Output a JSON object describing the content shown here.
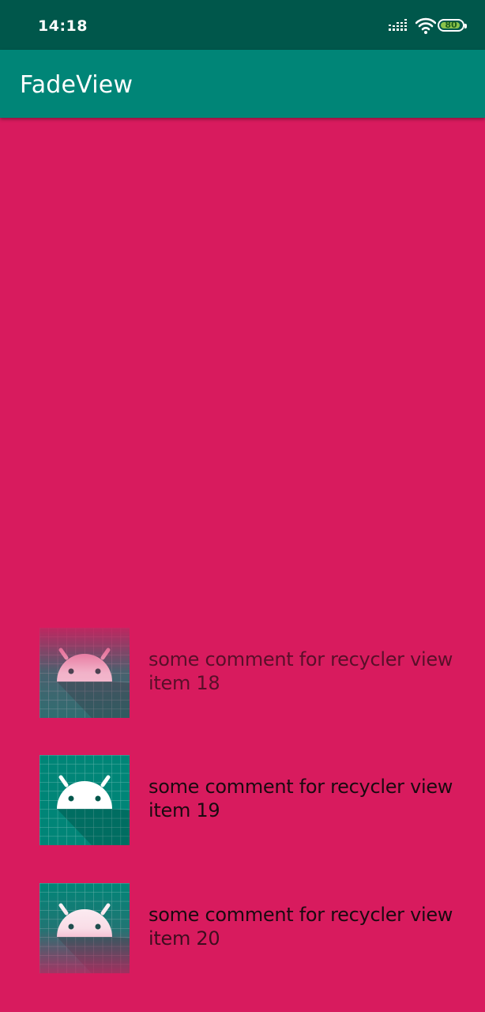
{
  "status_bar": {
    "time": "14:18",
    "battery": "80"
  },
  "app_bar": {
    "title": "FadeView"
  },
  "list": {
    "items": [
      {
        "comment": "some comment for recycler view",
        "label": "item 18",
        "icon": "android-launcher-icon"
      },
      {
        "comment": "some comment for recycler view",
        "label": "item 19",
        "icon": "android-launcher-icon"
      },
      {
        "comment": "some comment for recycler view",
        "label": "item 20",
        "icon": "android-launcher-icon"
      }
    ]
  },
  "colors": {
    "status_bar": "#00574b",
    "app_bar": "#008577",
    "background": "#d81b5e",
    "icon_teal": "#008577"
  }
}
